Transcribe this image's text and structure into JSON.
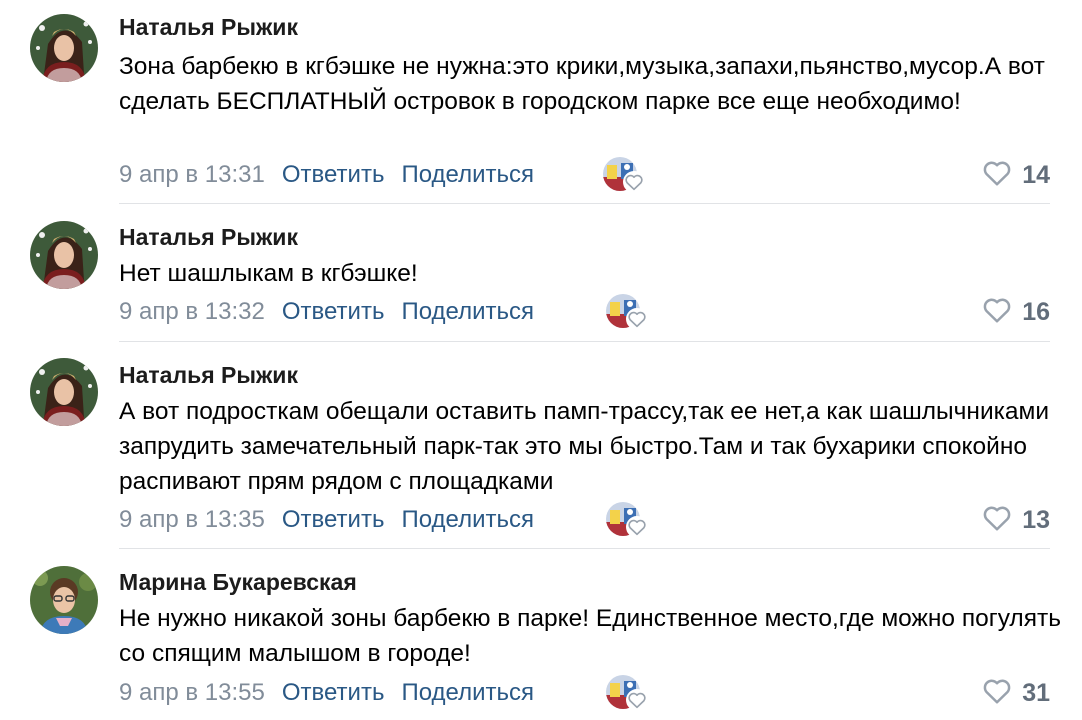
{
  "colors": {
    "link": "#2a5885",
    "meta_gray": "#818c99",
    "like_gray": "#626d7a",
    "divider": "#e1e3e6"
  },
  "comments": [
    {
      "author": "Наталья Рыжик",
      "text": "Зона барбекю в кгбэшке не нужна:это крики,музыка,запахи,пьянство,мусор.А вот сделать БЕСПЛАТНЫЙ островок в городском парке все еще необходимо!",
      "date": "9 апр в 13:31",
      "reply": "Ответить",
      "share": "Поделиться",
      "likes": "14"
    },
    {
      "author": "Наталья Рыжик",
      "text": "Нет шашлыкам в кгбэшке!",
      "date": "9 апр в 13:32",
      "reply": "Ответить",
      "share": "Поделиться",
      "likes": "16"
    },
    {
      "author": "Наталья Рыжик",
      "text": "А вот подросткам обещали оставить памп-трассу,так ее нет,а как шашлычниками запрудить замечательный парк-так это мы быстро.Там и так бухарики спокойно распивают прям рядом с площадками",
      "date": "9 апр в 13:35",
      "reply": "Ответить",
      "share": "Поделиться",
      "likes": "13"
    },
    {
      "author": "Марина Букаревская",
      "text": "Не нужно никакой зоны барбекю в парке! Единственное место,где можно погулять со спящим малышом в городе!",
      "date": "9 апр в 13:55",
      "reply": "Ответить",
      "share": "Поделиться",
      "likes": "31"
    }
  ]
}
